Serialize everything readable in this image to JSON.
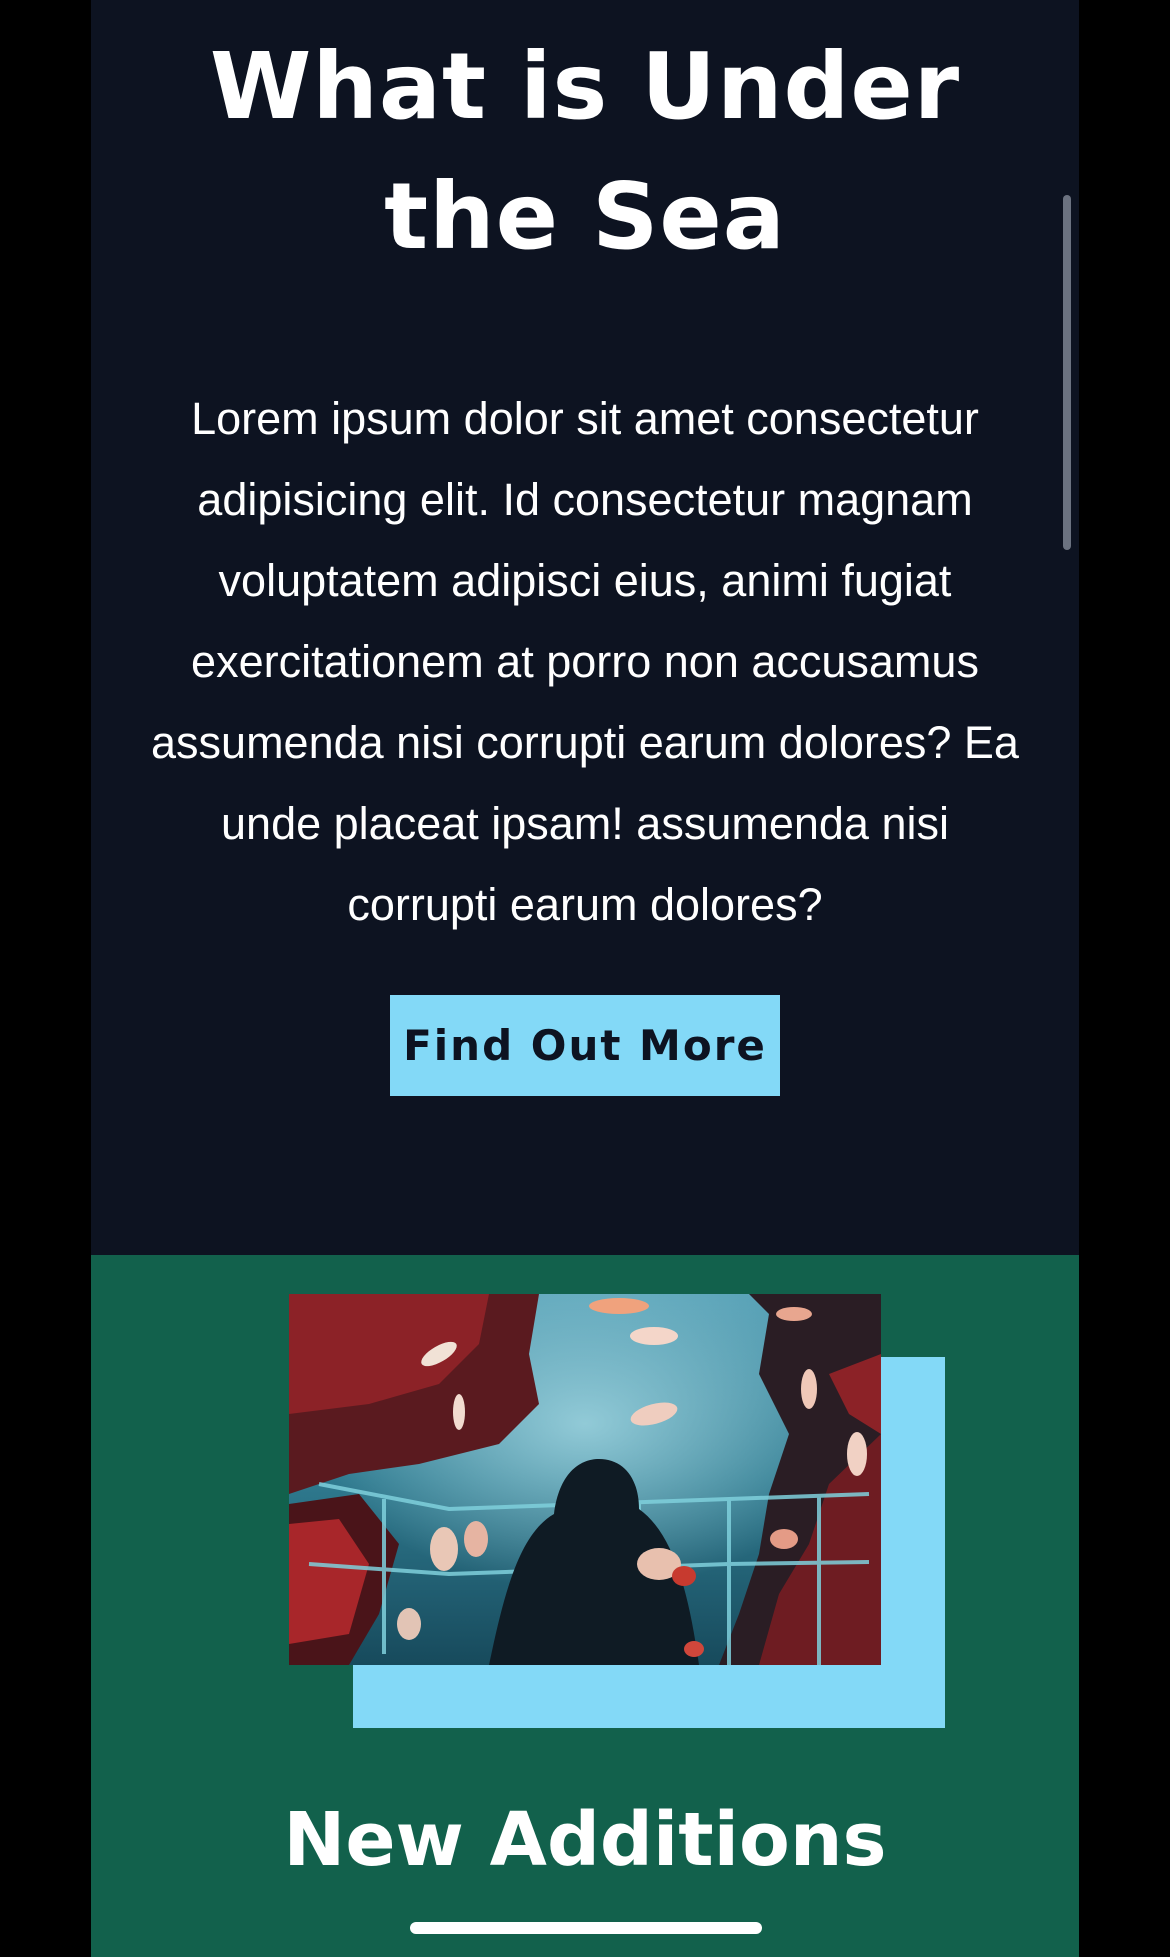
{
  "hero": {
    "title": "What is Under the Sea",
    "body": "Lorem ipsum dolor sit amet consectetur adipisicing elit. Id consectetur magnam voluptatem adipisci eius, animi fugiat exercitationem at porro non accusamus assumenda nisi corrupti earum dolores? Ea unde placeat ipsam! assumenda nisi corrupti earum dolores?",
    "button_label": "Find Out More",
    "background_color": "#0d1321",
    "button_color": "#83d9f7"
  },
  "feature": {
    "image_alt": "Person watching fish in an aquarium tunnel",
    "section_title": "New Additions",
    "background_color": "#12614c",
    "frame_color": "#83d9f7"
  }
}
